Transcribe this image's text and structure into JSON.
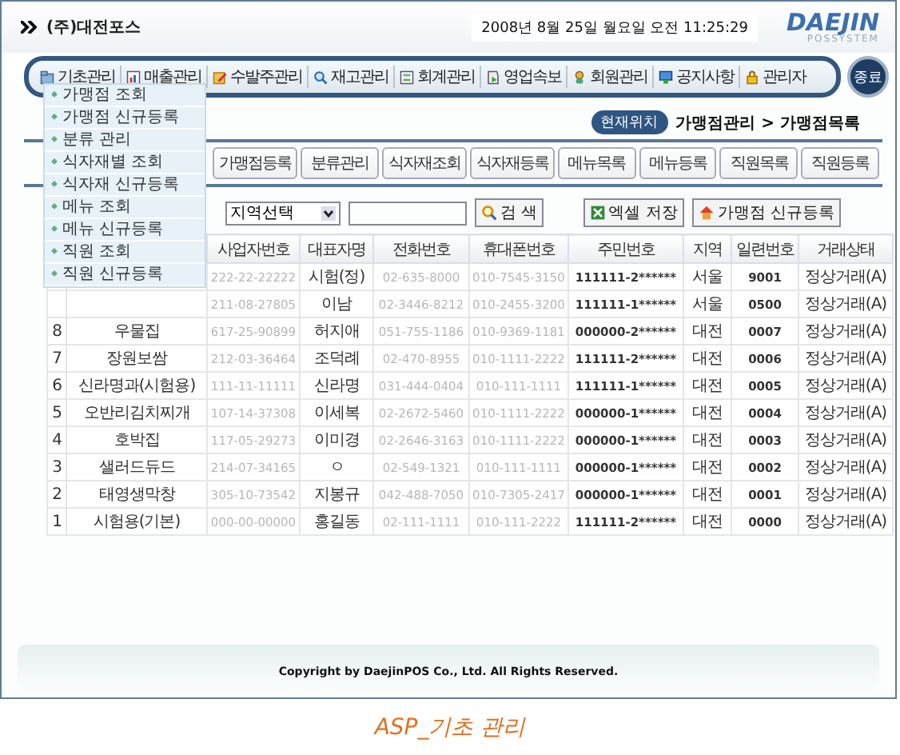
{
  "header": {
    "company": "(주)대전포스",
    "datetime": "2008년 8월 25일 월요일 오전 11:25:29",
    "logo": "DAEJIN",
    "logo_sub": "POSSYSTEM"
  },
  "menu": [
    "기초관리",
    "매출관리",
    "수발주관리",
    "재고관리",
    "회계관리",
    "영업속보",
    "회원관리",
    "공지사항",
    "관리자"
  ],
  "exit_button": "종료",
  "dropdown": [
    "가맹점 조회",
    "가맹점 신규등록",
    "분류 관리",
    "식자재별 조회",
    "식자재 신규등록",
    "메뉴 조회",
    "메뉴 신규등록",
    "직원 조회",
    "직원 신규등록"
  ],
  "breadcrumb": {
    "label": "현재위치",
    "path": "가맹점관리 > 가맹점목록"
  },
  "tabs": [
    "가맹점등록",
    "분류관리",
    "식자재조회",
    "식자재등록",
    "메뉴목록",
    "메뉴등록",
    "직원목록",
    "직원등록"
  ],
  "search": {
    "region_select": "지역선택",
    "button": "검 색"
  },
  "actions": [
    "엑셀 저장",
    "가맹점 신규등록"
  ],
  "table": {
    "columns": [
      "사업자번호",
      "대표자명",
      "전화번호",
      "휴대폰번호",
      "주민번호",
      "지역",
      "일련번호",
      "거래상태"
    ],
    "rows": [
      {
        "cells": [
          "222-22-22222",
          "시험(정)",
          "02-635-8000",
          "010-7545-3150",
          "111111-2******",
          "서울",
          "9001",
          "정상거래(A)"
        ]
      },
      {
        "cells": [
          "211-08-27805",
          "이남",
          "02-3446-8212",
          "010-2455-3200",
          "111111-1******",
          "서울",
          "0500",
          "정상거래(A)"
        ]
      },
      {
        "no": "8",
        "name": "우물집",
        "cells": [
          "617-25-90899",
          "허지애",
          "051-755-1186",
          "010-9369-1181",
          "000000-2******",
          "대전",
          "0007",
          "정상거래(A)"
        ]
      },
      {
        "no": "7",
        "name": "장원보쌈",
        "cells": [
          "212-03-36464",
          "조덕례",
          "02-470-8955",
          "010-1111-2222",
          "111111-2******",
          "대전",
          "0006",
          "정상거래(A)"
        ]
      },
      {
        "no": "6",
        "name": "신라명과(시험용)",
        "cells": [
          "111-11-11111",
          "신라명",
          "031-444-0404",
          "010-111-1111",
          "111111-1******",
          "대전",
          "0005",
          "정상거래(A)"
        ]
      },
      {
        "no": "5",
        "name": "오반리김치찌개",
        "cells": [
          "107-14-37308",
          "이세복",
          "02-2672-5460",
          "010-1111-2222",
          "000000-1******",
          "대전",
          "0004",
          "정상거래(A)"
        ]
      },
      {
        "no": "4",
        "name": "호박집",
        "cells": [
          "117-05-29273",
          "이미경",
          "02-2646-3163",
          "010-1111-2222",
          "000000-1******",
          "대전",
          "0003",
          "정상거래(A)"
        ]
      },
      {
        "no": "3",
        "name": "샐러드듀드",
        "cells": [
          "214-07-34165",
          "ㅇ",
          "02-549-1321",
          "010-111-1111",
          "000000-1******",
          "대전",
          "0002",
          "정상거래(A)"
        ]
      },
      {
        "no": "2",
        "name": "태영생막창",
        "cells": [
          "305-10-73542",
          "지봉규",
          "042-488-7050",
          "010-7305-2417",
          "000000-1******",
          "대전",
          "0001",
          "정상거래(A)"
        ]
      },
      {
        "no": "1",
        "name": "시험용(기본)",
        "cells": [
          "000-00-00000",
          "홍길동",
          "02-111-1111",
          "010-111-2222",
          "111111-2******",
          "대전",
          "0000",
          "정상거래(A)"
        ]
      }
    ]
  },
  "footer": "Copyright by DaejinPOS Co., Ltd. All Rights Reserved.",
  "caption": "ASP_기초 관리"
}
